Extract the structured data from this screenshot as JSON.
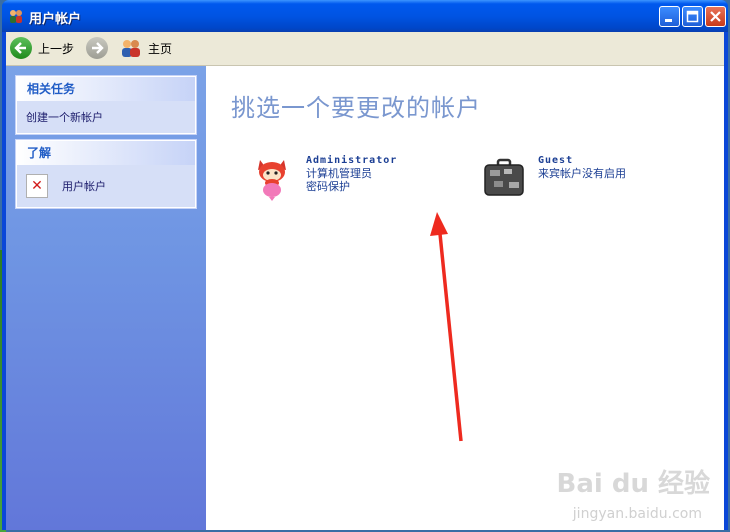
{
  "window": {
    "title": "用户帐户"
  },
  "toolbar": {
    "back_label": "上一步",
    "home_label": "主页"
  },
  "sidebar": {
    "related_tasks": {
      "header": "相关任务",
      "items": [
        {
          "label": "创建一个新帐户"
        }
      ]
    },
    "learn": {
      "header": "了解",
      "items": [
        {
          "label": "用户帐户"
        }
      ]
    }
  },
  "main": {
    "title": "挑选一个要更改的帐户",
    "accounts": [
      {
        "name": "Administrator",
        "lines": [
          "计算机管理员",
          "密码保护"
        ]
      },
      {
        "name": "Guest",
        "lines": [
          "来宾帐户没有启用"
        ]
      }
    ]
  },
  "watermark": {
    "text": "Bai du 经验",
    "sub": "jingyan.baidu.com"
  },
  "colors": {
    "title_bar": "#0054e3",
    "sidebar": "#6f95e3",
    "link": "#215dc6",
    "annotation_arrow": "#ee2a1f"
  }
}
